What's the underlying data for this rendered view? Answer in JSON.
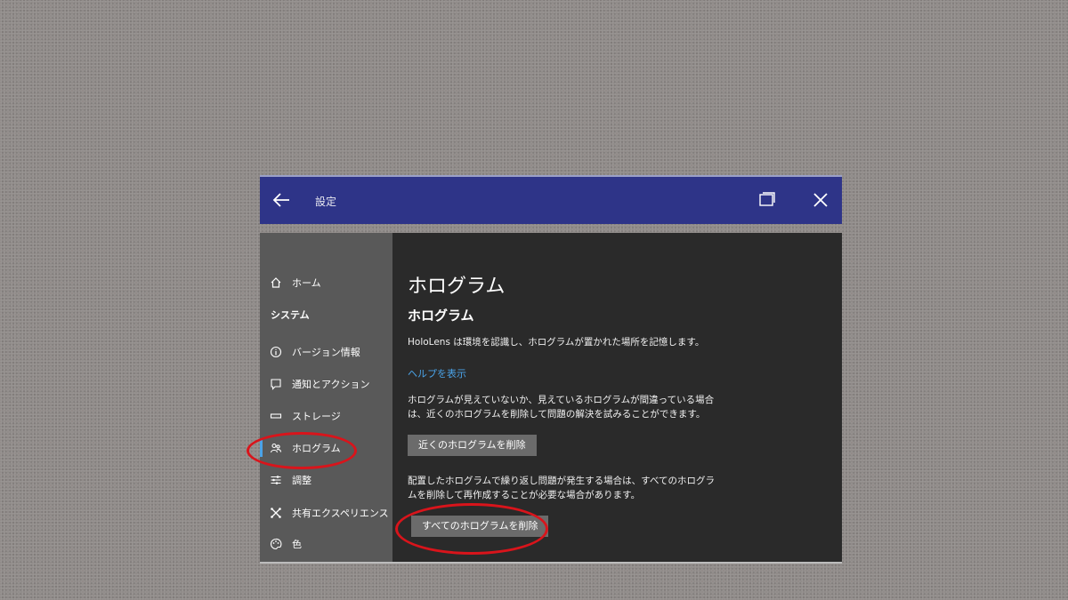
{
  "window": {
    "title": "設定"
  },
  "sidebar": {
    "home": "ホーム",
    "section_title": "システム",
    "items": [
      {
        "label": "バージョン情報",
        "icon": "info-icon"
      },
      {
        "label": "通知とアクション",
        "icon": "notification-icon"
      },
      {
        "label": "ストレージ",
        "icon": "storage-icon"
      },
      {
        "label": "ホログラム",
        "icon": "holograms-icon",
        "active": true
      },
      {
        "label": "調整",
        "icon": "calibration-icon"
      },
      {
        "label": "共有エクスペリエンス",
        "icon": "shared-experiences-icon"
      },
      {
        "label": "色",
        "icon": "color-icon"
      }
    ]
  },
  "main": {
    "page_title": "ホログラム",
    "section_title": "ホログラム",
    "description": "HoloLens は環境を認識し、ホログラムが置かれた場所を記憶します。",
    "help_link": "ヘルプを表示",
    "nearby_text": "ホログラムが見えていないか、見えているホログラムが間違っている場合は、近くのホログラムを削除して問題の解決を試みることができます。",
    "nearby_button": "近くのホログラムを削除",
    "all_text": "配置したホログラムで繰り返し問題が発生する場合は、すべてのホログラムを削除して再作成することが必要な場合があります。",
    "all_button": "すべてのホログラムを削除"
  },
  "colors": {
    "titlebar": "#2e3488",
    "sidebar": "#595959",
    "content": "#2a2a2a",
    "accent": "#4aa3e8",
    "annotation": "#d9141b"
  }
}
